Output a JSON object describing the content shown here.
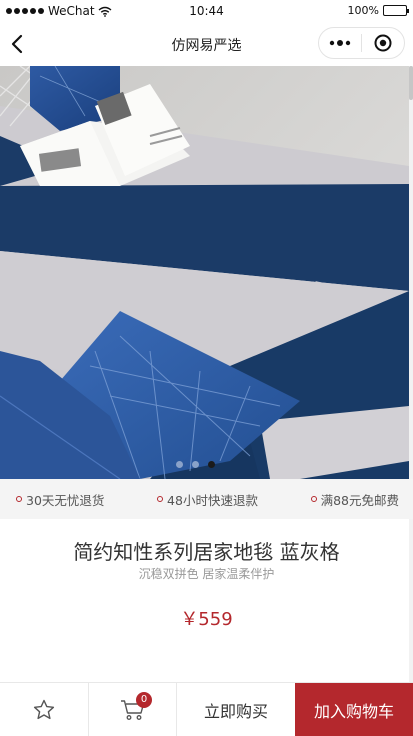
{
  "status_bar": {
    "carrier": "WeChat",
    "time": "10:44",
    "battery": "100%"
  },
  "navbar": {
    "title": "仿网易严选",
    "back_icon": "chevron-left-icon",
    "more_icon": "more-dots-icon",
    "close_icon": "target-circle-icon"
  },
  "gallery": {
    "image_description": "navy and grey geometric rug with pillows and open magazine",
    "slide_count": 3,
    "active_slide": 3
  },
  "services": [
    {
      "label": "30天无忧退货"
    },
    {
      "label": "48小时快速退款"
    },
    {
      "label": "满88元免邮费"
    }
  ],
  "product": {
    "title": "简约知性系列居家地毯 蓝灰格",
    "subtitle": "沉稳双拼色 居家温柔伴护",
    "price": "￥559"
  },
  "bottom_bar": {
    "favorite_icon": "star-outline-icon",
    "cart_icon": "shopping-cart-icon",
    "cart_count": "0",
    "buy_now": "立即购买",
    "add_to_cart": "加入购物车"
  },
  "colors": {
    "accent": "#b4282d",
    "navy": "#1c3d6b",
    "rug_grey": "#cfcdd2",
    "service_bg": "#f4f4f4"
  }
}
